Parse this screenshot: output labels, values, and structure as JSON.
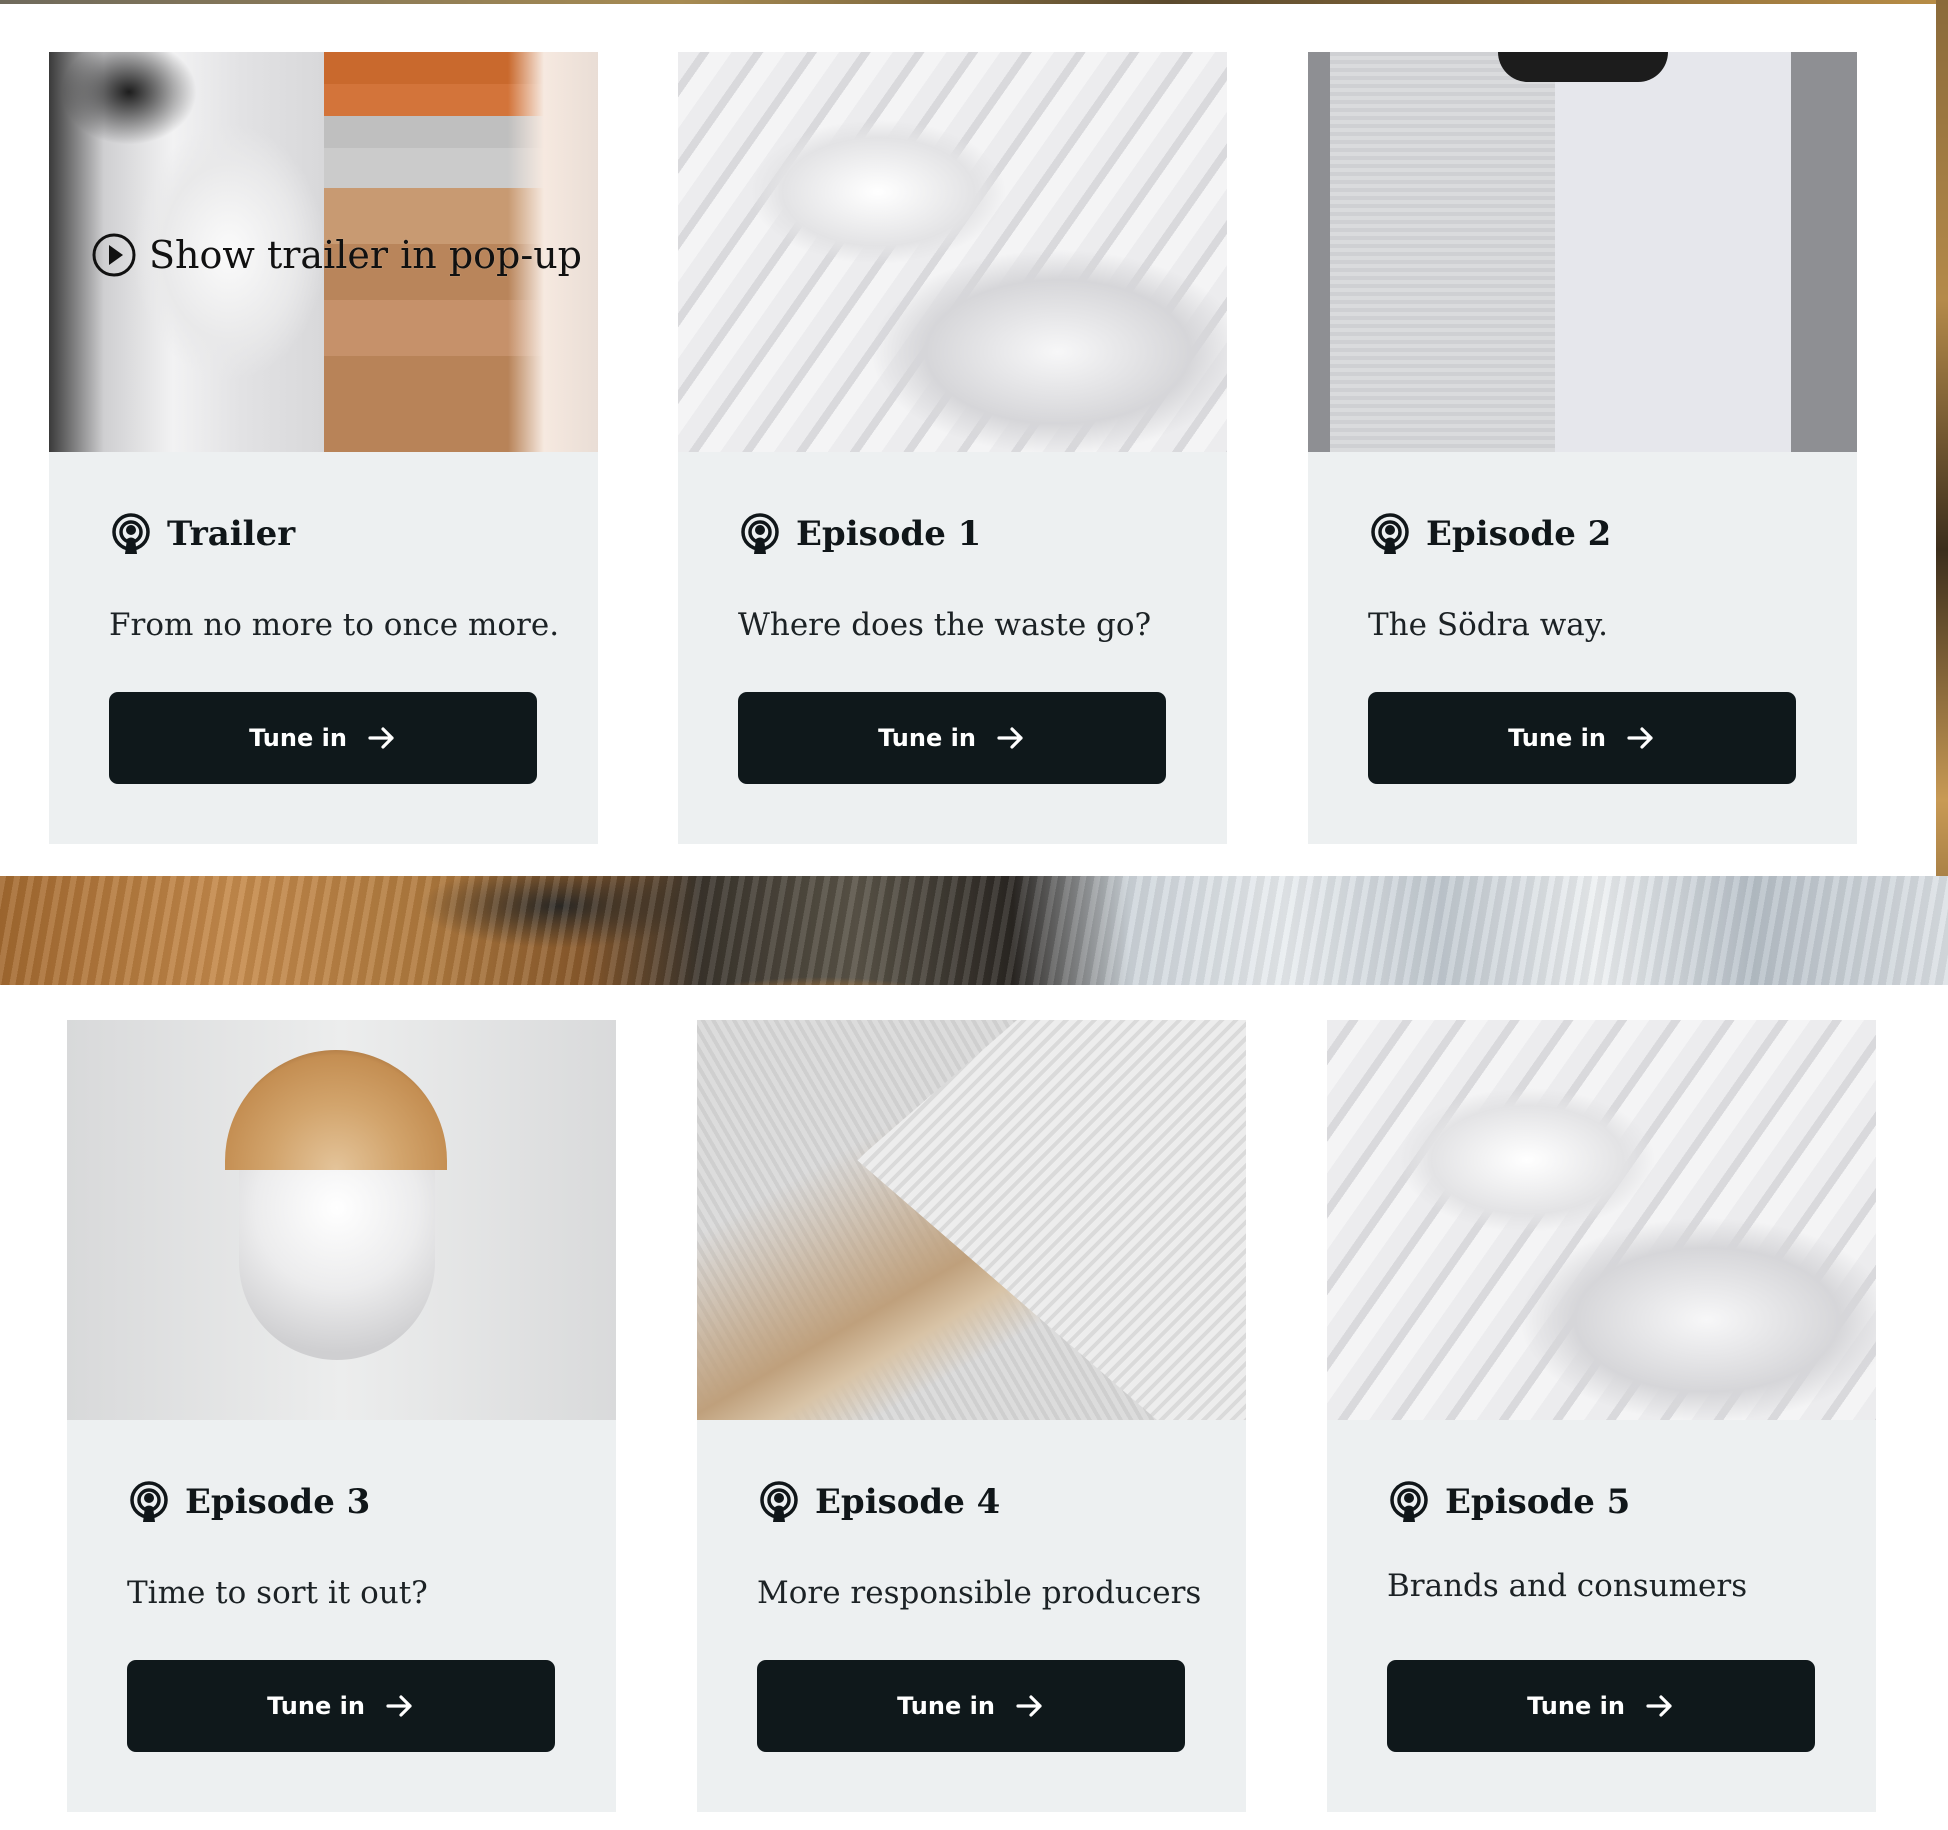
{
  "row1": [
    {
      "id": "trailer",
      "thumb": "folded-clothes-image",
      "overlay_link": "Show trailer in pop-up",
      "title": "Trailer",
      "description": "From no more to once more.",
      "button": "Tune in"
    },
    {
      "id": "episode-1",
      "thumb": "white-sheet-image",
      "title": "Episode 1",
      "description": "Where does the waste go?",
      "button": "Tune in"
    },
    {
      "id": "episode-2",
      "thumb": "towel-tshirt-image",
      "title": "Episode 2",
      "description": "The Södra way.",
      "button": "Tune in"
    }
  ],
  "row2": [
    {
      "id": "episode-3",
      "thumb": "log-cotton-image",
      "title": "Episode 3",
      "description": "Time to sort it out?",
      "button": "Tune in"
    },
    {
      "id": "episode-4",
      "thumb": "paper-sheet-image",
      "title": "Episode 4",
      "description": "More responsible producers",
      "button": "Tune in"
    },
    {
      "id": "episode-5",
      "thumb": "white-sheet-image",
      "title": "Episode 5",
      "description": "Brands and consumers",
      "button": "Tune in"
    }
  ],
  "icons": {
    "title_icon": "podcast-icon",
    "button_icon": "arrow-right-icon",
    "play_icon": "play-circle-icon"
  },
  "colors": {
    "button_bg": "#0f181b",
    "card_bg": "#edf0f1",
    "text": "#101619"
  }
}
